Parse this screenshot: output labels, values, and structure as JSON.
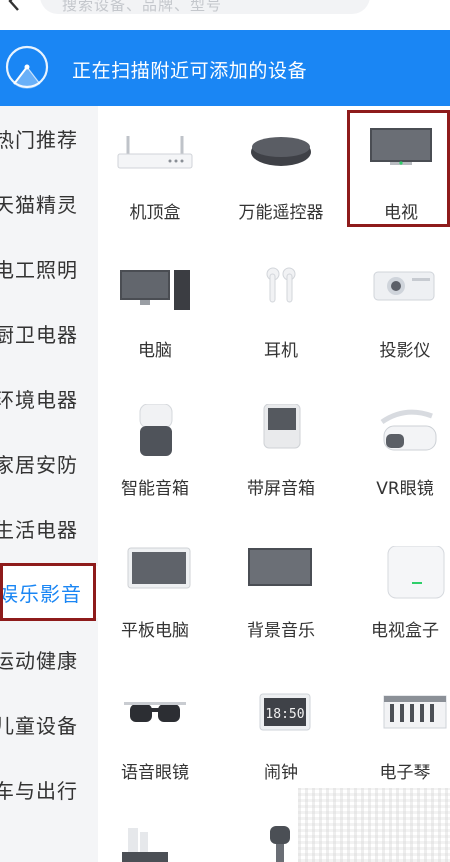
{
  "header": {
    "search_placeholder": "搜索设备、品牌、型号"
  },
  "banner": {
    "text": "正在扫描附近可添加的设备"
  },
  "sidebar": {
    "items": [
      {
        "label": "热门推荐"
      },
      {
        "label": "天猫精灵"
      },
      {
        "label": "电工照明"
      },
      {
        "label": "厨卫电器"
      },
      {
        "label": "环境电器"
      },
      {
        "label": "家居安防"
      },
      {
        "label": "生活电器"
      },
      {
        "label": "娱乐影音",
        "active": true
      },
      {
        "label": "运动健康"
      },
      {
        "label": "儿童设备"
      },
      {
        "label": "车与出行"
      }
    ]
  },
  "devices": [
    {
      "label": "机顶盒",
      "icon": "set-top-box-icon"
    },
    {
      "label": "万能遥控器",
      "icon": "universal-remote-icon"
    },
    {
      "label": "电视",
      "icon": "tv-icon"
    },
    {
      "label": "电脑",
      "icon": "computer-icon"
    },
    {
      "label": "耳机",
      "icon": "earphones-icon"
    },
    {
      "label": "投影仪",
      "icon": "projector-icon"
    },
    {
      "label": "智能音箱",
      "icon": "smart-speaker-icon"
    },
    {
      "label": "带屏音箱",
      "icon": "screen-speaker-icon"
    },
    {
      "label": "VR眼镜",
      "icon": "vr-headset-icon"
    },
    {
      "label": "平板电脑",
      "icon": "tablet-icon"
    },
    {
      "label": "背景音乐",
      "icon": "background-music-icon"
    },
    {
      "label": "电视盒子",
      "icon": "tv-box-icon"
    },
    {
      "label": "语音眼镜",
      "icon": "voice-glasses-icon"
    },
    {
      "label": "闹钟",
      "icon": "alarm-clock-icon"
    },
    {
      "label": "电子琴",
      "icon": "keyboard-icon"
    }
  ],
  "alarm_display": "18:50",
  "colors": {
    "accent": "#1a86f4",
    "highlight_border": "#8e1b1b"
  }
}
